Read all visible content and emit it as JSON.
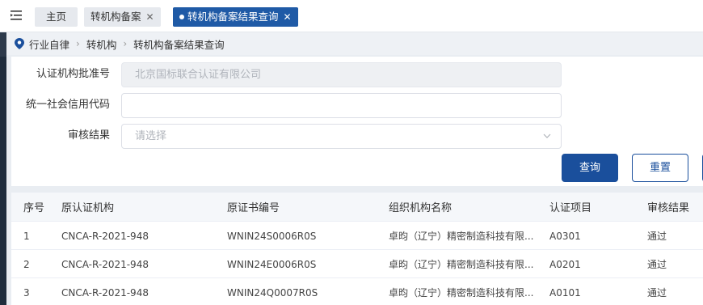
{
  "tabs": [
    {
      "label": "主页",
      "closable": false,
      "active": false
    },
    {
      "label": "转机构备案",
      "closable": true,
      "active": false
    },
    {
      "label": "转机构备案结果查询",
      "closable": true,
      "active": true
    }
  ],
  "breadcrumb": [
    "行业自律",
    "转机构",
    "转机构备案结果查询"
  ],
  "form": {
    "approval_no_label": "认证机构批准号",
    "approval_no_value": "北京国标联合认证有限公司",
    "credit_code_label": "统一社会信用代码",
    "credit_code_value": "",
    "result_label": "审核结果",
    "result_placeholder": "请选择"
  },
  "buttons": {
    "query": "查询",
    "reset": "重置"
  },
  "table": {
    "headers": [
      "序号",
      "原认证机构",
      "原证书编号",
      "组织机构名称",
      "认证项目",
      "审核结果"
    ],
    "rows": [
      [
        "1",
        "CNCA-R-2021-948",
        "WNIN24S0006R0S",
        "卓昀（辽宁）精密制造科技有限...",
        "A0301",
        "通过"
      ],
      [
        "2",
        "CNCA-R-2021-948",
        "WNIN24E0006R0S",
        "卓昀（辽宁）精密制造科技有限...",
        "A0201",
        "通过"
      ],
      [
        "3",
        "CNCA-R-2021-948",
        "WNIN24Q0007R0S",
        "卓昀（辽宁）精密制造科技有限...",
        "A0101",
        "通过"
      ]
    ]
  },
  "colors": {
    "primary": "#1a4f9c",
    "active_tab": "#1f5aa6"
  },
  "icons": {
    "menu": "hamburger-icon",
    "location": "location-pin-icon",
    "close": "close-icon",
    "chevron": "chevron-down-icon"
  }
}
